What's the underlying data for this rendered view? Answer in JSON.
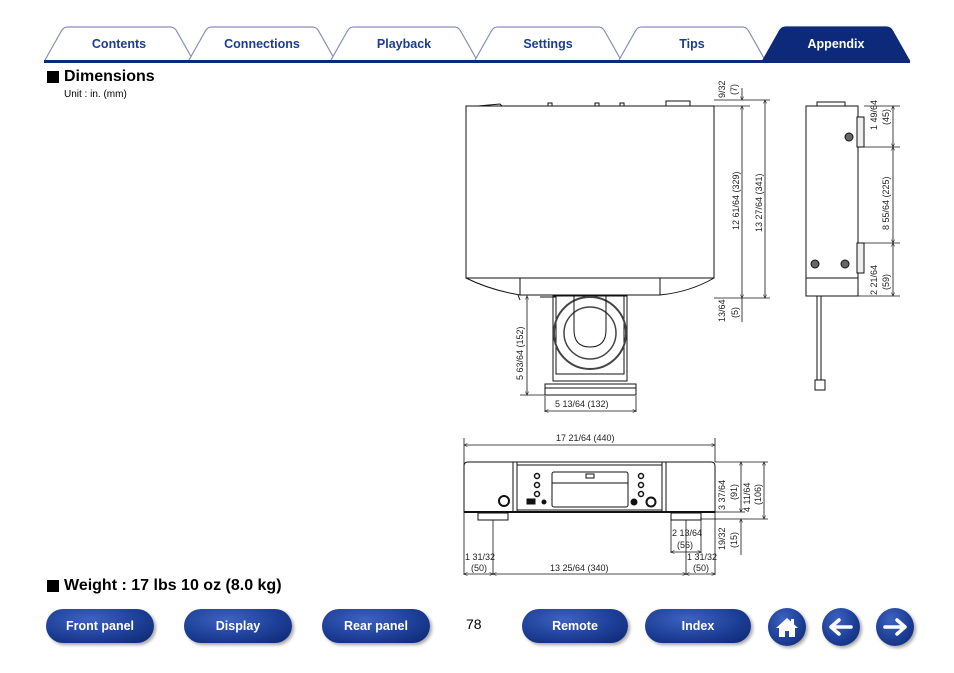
{
  "tabs": [
    {
      "label": "Contents",
      "active": false
    },
    {
      "label": "Connections",
      "active": false
    },
    {
      "label": "Playback",
      "active": false
    },
    {
      "label": "Settings",
      "active": false
    },
    {
      "label": "Tips",
      "active": false
    },
    {
      "label": "Appendix",
      "active": true
    }
  ],
  "colors": {
    "brand": "#1c3d8f",
    "active_tab": "#0d2a7a",
    "button": "#1d3f97"
  },
  "sections": {
    "dimensions": {
      "title": "Dimensions",
      "unit": "Unit : in. (mm)"
    },
    "weight": {
      "title": "Weight : 17 lbs 10 oz (8.0 kg)"
    }
  },
  "dimensions": {
    "top_view": {
      "rear_protrusion": [
        "9/32",
        "(7)"
      ],
      "depth_body": "12 61/64 (329)",
      "depth_total": "13 27/64 (341)",
      "front_protrusion": [
        "13/64",
        "(5)"
      ],
      "tray_extension": "5 63/64 (152)",
      "tray_width": "5 13/64 (132)"
    },
    "side_view": {
      "top_offset": [
        "1 49/64",
        "(45)"
      ],
      "foot_spacing": "8 55/64 (225)",
      "bottom_offset": [
        "2 21/64",
        "(59)"
      ]
    },
    "front_view": {
      "width": "17 21/64 (440)",
      "body_height": [
        "3 37/64",
        "(91)"
      ],
      "total_height": [
        "4 11/64",
        "(106)"
      ],
      "foot_height": [
        "19/32",
        "(15)"
      ],
      "foot_width": [
        "2 13/64",
        "(56)"
      ],
      "left_offset": [
        "1 31/32",
        "(50)"
      ],
      "foot_spacing": "13 25/64 (340)",
      "right_offset": [
        "1 31/32",
        "(50)"
      ]
    }
  },
  "page_number": "78",
  "footer_buttons": [
    {
      "label": "Front panel"
    },
    {
      "label": "Display"
    },
    {
      "label": "Rear panel"
    },
    {
      "label": "Remote"
    },
    {
      "label": "Index"
    }
  ],
  "nav_icons": {
    "home": "home-icon",
    "back": "arrow-left-icon",
    "forward": "arrow-right-icon"
  }
}
